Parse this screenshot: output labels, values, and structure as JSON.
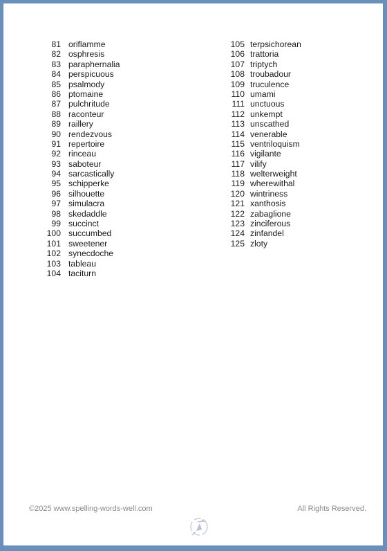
{
  "words_left": [
    {
      "num": "81",
      "word": "oriflamme"
    },
    {
      "num": "82",
      "word": "osphresis"
    },
    {
      "num": "83",
      "word": "paraphernalia"
    },
    {
      "num": "84",
      "word": "perspicuous"
    },
    {
      "num": "85",
      "word": "psalmody"
    },
    {
      "num": "86",
      "word": "ptomaine"
    },
    {
      "num": "87",
      "word": "pulchritude"
    },
    {
      "num": "88",
      "word": "raconteur"
    },
    {
      "num": "89",
      "word": "raillery"
    },
    {
      "num": "90",
      "word": "rendezvous"
    },
    {
      "num": "91",
      "word": "repertoire"
    },
    {
      "num": "92",
      "word": "rinceau"
    },
    {
      "num": "93",
      "word": "saboteur"
    },
    {
      "num": "94",
      "word": "sarcastically"
    },
    {
      "num": "95",
      "word": "schipperke"
    },
    {
      "num": "96",
      "word": "silhouette"
    },
    {
      "num": "97",
      "word": "simulacra"
    },
    {
      "num": "98",
      "word": "skedaddle"
    },
    {
      "num": "99",
      "word": "succinct"
    },
    {
      "num": "100",
      "word": "succumbed"
    },
    {
      "num": "101",
      "word": "sweetener"
    },
    {
      "num": "102",
      "word": "synecdoche"
    },
    {
      "num": "103",
      "word": "tableau"
    },
    {
      "num": "104",
      "word": "taciturn"
    }
  ],
  "words_right": [
    {
      "num": "105",
      "word": "terpsichorean"
    },
    {
      "num": "106",
      "word": "trattoria"
    },
    {
      "num": "107",
      "word": "triptych"
    },
    {
      "num": "108",
      "word": "troubadour"
    },
    {
      "num": "109",
      "word": "truculence"
    },
    {
      "num": "110",
      "word": "umami"
    },
    {
      "num": "111",
      "word": "unctuous"
    },
    {
      "num": "112",
      "word": "unkempt"
    },
    {
      "num": "113",
      "word": "unscathed"
    },
    {
      "num": "114",
      "word": "venerable"
    },
    {
      "num": "115",
      "word": "ventriloquism"
    },
    {
      "num": "116",
      "word": "vigilante"
    },
    {
      "num": "117",
      "word": "vilify"
    },
    {
      "num": "118",
      "word": "welterweight"
    },
    {
      "num": "119",
      "word": "wherewithal"
    },
    {
      "num": "120",
      "word": "wintriness"
    },
    {
      "num": "121",
      "word": "xanthosis"
    },
    {
      "num": "122",
      "word": "zabaglione"
    },
    {
      "num": "123",
      "word": "zinciferous"
    },
    {
      "num": "124",
      "word": "zinfandel"
    },
    {
      "num": "125",
      "word": "zloty"
    }
  ],
  "footer": {
    "copyright": "©2025 www.spelling-words-well.com",
    "rights": "All Rights Reserved.",
    "logo_icon": "spelling-words-well-logo-icon"
  },
  "colors": {
    "frame": "#6b8fbb",
    "page": "#ffffff",
    "text": "#1a1a1a",
    "footer_text": "#8a8a8a"
  }
}
